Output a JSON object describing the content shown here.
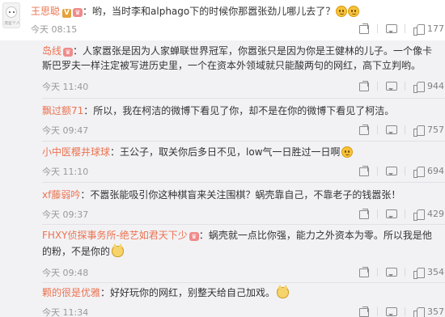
{
  "top": {
    "username": "王思聪",
    "verified_badge": "V",
    "text": "：哟，当时李和alphago下的时候你那嚣张劲儿哪儿去了？",
    "time": "今天 08:15",
    "like_count": "177",
    "avatar_caption": "流星个人秀"
  },
  "replies": [
    {
      "username": "岛线",
      "line1": "：人家嚣张是因为人家蝉联世界冠军，你嚣张只是因为你是王健林的儿子。一个像卡",
      "line2": "斯巴罗夫一样注定被写进历史里，一个在资本外领域就只能酸两句的网红，高下立判哟。",
      "time": "今天 11:40",
      "like_count": "944"
    },
    {
      "username": "飘过额71",
      "line1": "：所以，我在柯洁的微博下看见了你，却不是在你的微博下看见了柯洁。",
      "time": "今天 09:47",
      "like_count": "757"
    },
    {
      "username": "小中医樱井球球",
      "line1": "：王公子，取关你后多日不见，low气一日胜过一日啊",
      "time": "今天 11:10",
      "like_count": "694"
    },
    {
      "username": "xf藤弱吟",
      "line1": "：不嚣张能吸引你这种棋盲来关注围棋？蜗壳靠自己，不靠老子的钱嚣张！",
      "time": "今天 09:37",
      "like_count": "429"
    },
    {
      "username": "FHXY侦探事务所-绝艺如君天下少",
      "line1": "：蜗壳就一点比你强，能力之外资本为零。所以我是他",
      "line2": "的粉，不是你的",
      "time": "今天 09:48",
      "like_count": "354"
    },
    {
      "username": "颗的很是优雅",
      "line1": "：好好玩你的网红，别整天给自己加戏。",
      "time": "今天 11:34",
      "like_count": "357"
    }
  ],
  "icons": {
    "share": "share-icon",
    "comment": "comment-icon",
    "like": "thumbs-up-icon"
  },
  "colors": {
    "username": "#eb7350",
    "meta": "#999999",
    "feed_bg": "#f2f2f5"
  }
}
